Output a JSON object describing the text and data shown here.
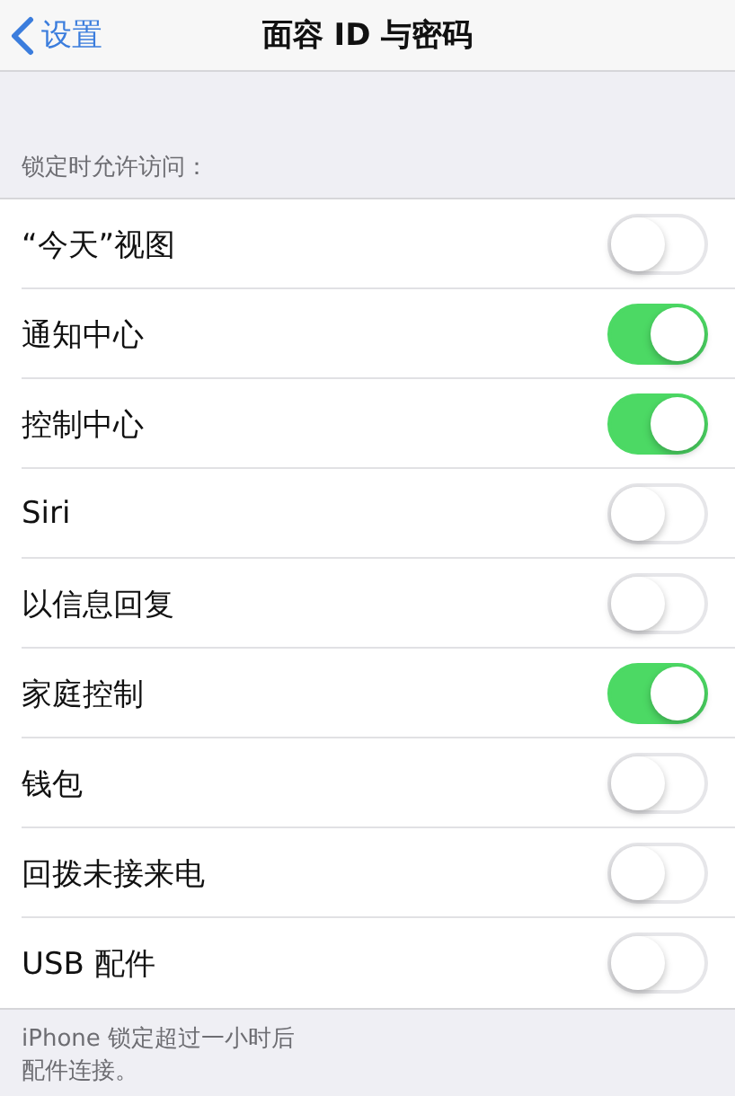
{
  "nav": {
    "back": "设置",
    "title": "面容 ID 与密码"
  },
  "section_header": "锁定时允许访问：",
  "rows": [
    {
      "label": "“今天”视图",
      "on": false
    },
    {
      "label": "通知中心",
      "on": true
    },
    {
      "label": "控制中心",
      "on": true
    },
    {
      "label": "Siri",
      "on": false
    },
    {
      "label": "以信息回复",
      "on": false
    },
    {
      "label": "家庭控制",
      "on": true
    },
    {
      "label": "钱包",
      "on": false
    },
    {
      "label": "回拨未接来电",
      "on": false
    },
    {
      "label": "USB 配件",
      "on": false
    }
  ],
  "footer": [
    "iPhone 锁定超过一小时后",
    "配件连接。"
  ]
}
